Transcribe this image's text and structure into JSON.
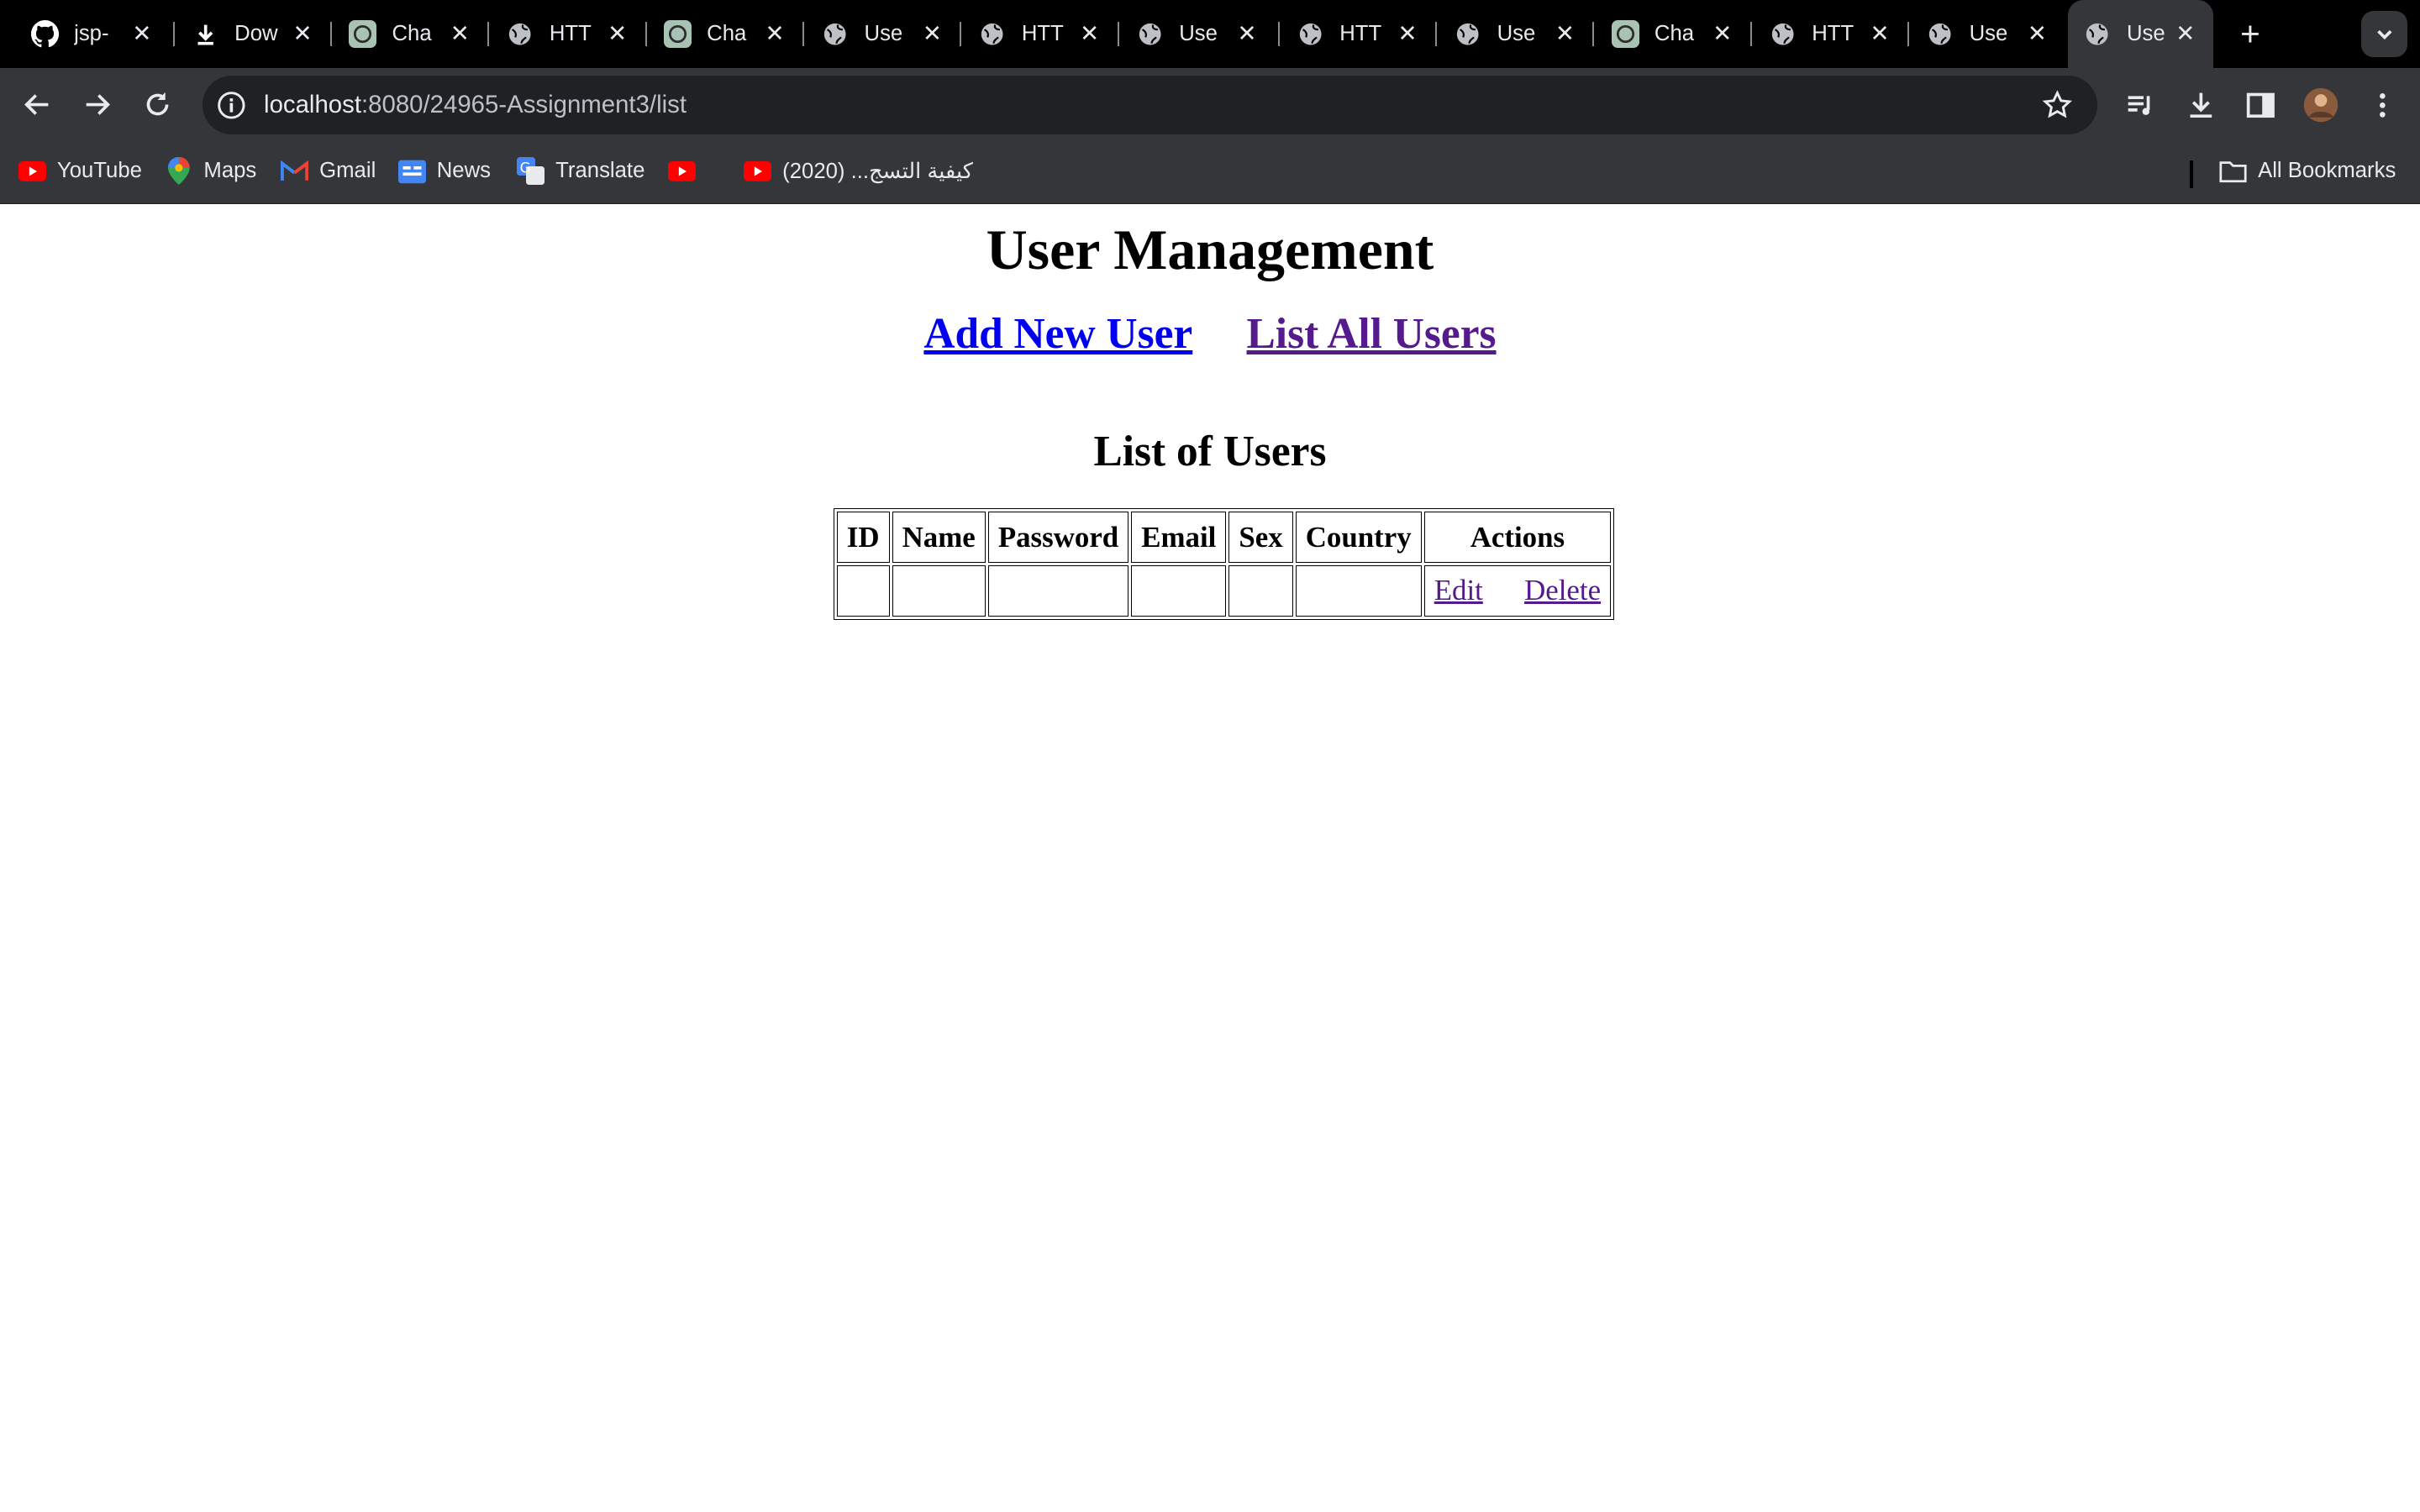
{
  "tabs": [
    {
      "title": "jsp-",
      "icon": "github-icon"
    },
    {
      "title": "Dow",
      "icon": "download-icon"
    },
    {
      "title": "Cha",
      "icon": "chatgpt-icon"
    },
    {
      "title": "HTT",
      "icon": "globe-icon"
    },
    {
      "title": "Cha",
      "icon": "chatgpt-icon"
    },
    {
      "title": "Use",
      "icon": "globe-icon"
    },
    {
      "title": "HTT",
      "icon": "globe-icon"
    },
    {
      "title": "Use",
      "icon": "globe-icon"
    },
    {
      "title": "HTT",
      "icon": "globe-icon"
    },
    {
      "title": "Use",
      "icon": "globe-icon"
    },
    {
      "title": "Cha",
      "icon": "chatgpt-icon"
    },
    {
      "title": "HTT",
      "icon": "globe-icon"
    },
    {
      "title": "Use",
      "icon": "globe-icon"
    },
    {
      "title": "Use",
      "icon": "globe-icon"
    }
  ],
  "address_bar": {
    "host": "localhost",
    "path": ":8080/24965-Assignment3/list"
  },
  "bookmarks": {
    "youtube": "YouTube",
    "maps": "Maps",
    "gmail": "Gmail",
    "news": "News",
    "translate": "Translate",
    "video": "كيفية التسج... (2020)",
    "all": "All Bookmarks"
  },
  "page": {
    "title": "User Management",
    "add_link": "Add New User",
    "list_link": "List All Users",
    "subtitle": "List of Users",
    "headers": [
      "ID",
      "Name",
      "Password",
      "Email",
      "Sex",
      "Country",
      "Actions"
    ],
    "edit_label": "Edit",
    "delete_label": "Delete"
  },
  "colors": {
    "link": "#0000ee",
    "visited": "#551a8b",
    "chrome_dark": "#35363a"
  }
}
